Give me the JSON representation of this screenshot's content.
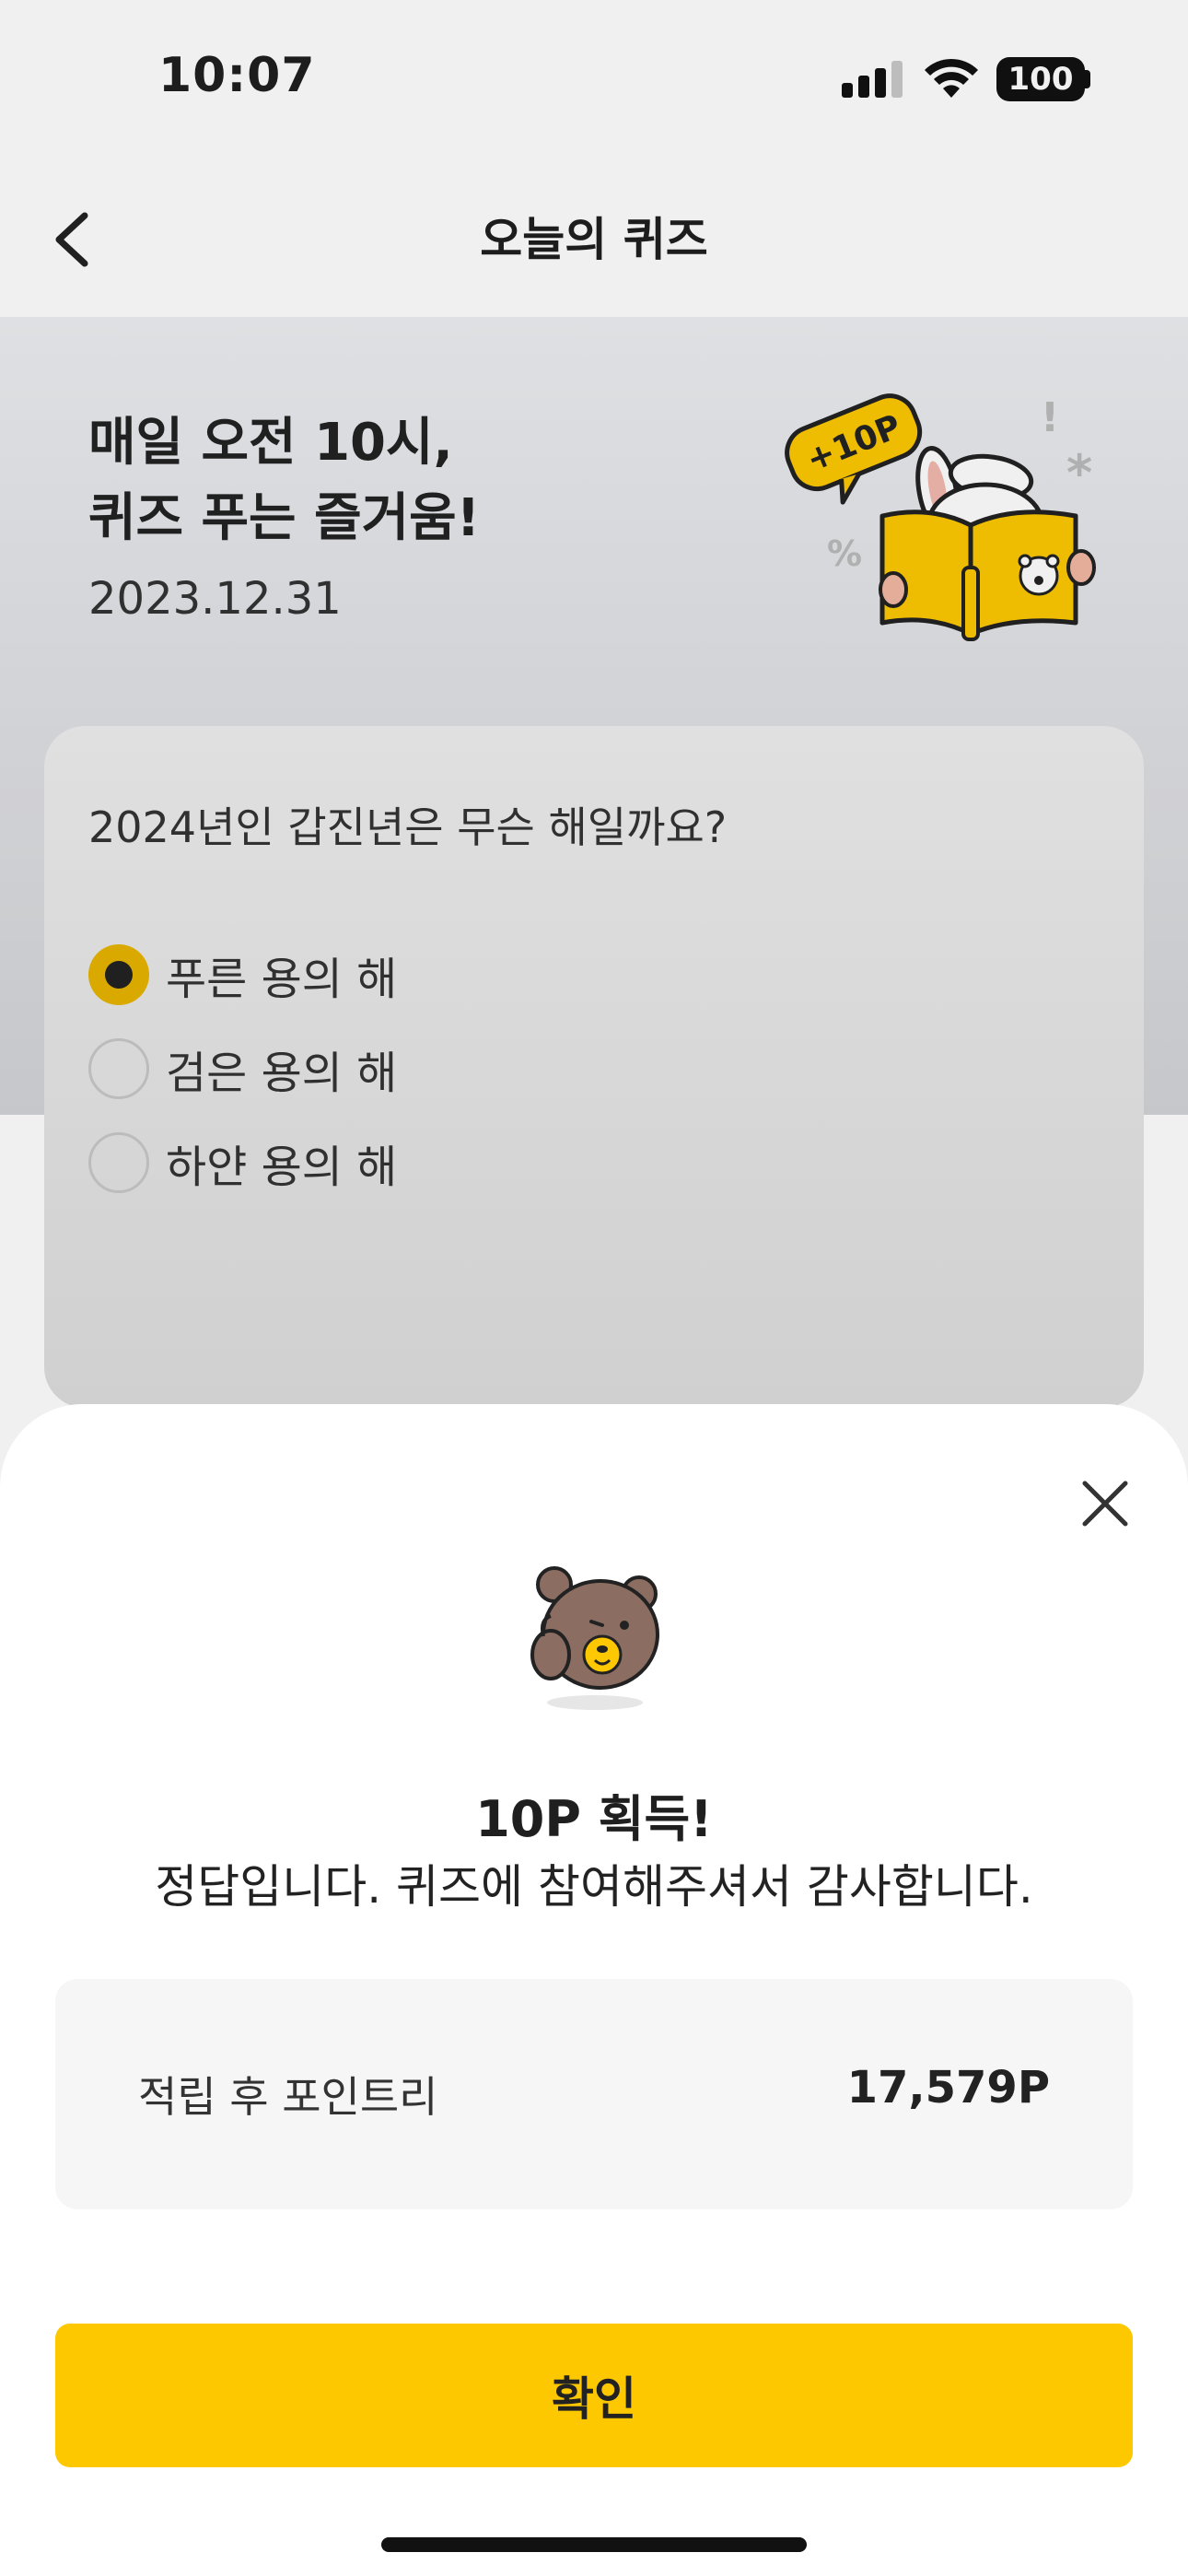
{
  "status_bar": {
    "time": "10:07",
    "battery": "100"
  },
  "nav": {
    "title": "오늘의 퀴즈",
    "back_icon": "chevron-left-icon"
  },
  "hero": {
    "title_line1": "매일 오전 10시,",
    "title_line2": "퀴즈 푸는 즐거움!",
    "date": "2023.12.31",
    "badge": "+10P"
  },
  "quiz": {
    "question": "2024년인 갑진년은 무슨 해일까요?",
    "options": [
      {
        "label": "푸른 용의 해",
        "selected": true
      },
      {
        "label": "검은 용의 해",
        "selected": false
      },
      {
        "label": "하얀 용의 해",
        "selected": false
      }
    ]
  },
  "sheet": {
    "result_title": "10P 획득!",
    "result_desc": "정답입니다. 퀴즈에 참여해주셔서 감사합니다.",
    "points_label": "적립 후 포인트리",
    "points_value": "17,579P",
    "confirm_label": "확인"
  },
  "colors": {
    "accent": "#fdc800",
    "selected_radio": "#e8b400"
  }
}
